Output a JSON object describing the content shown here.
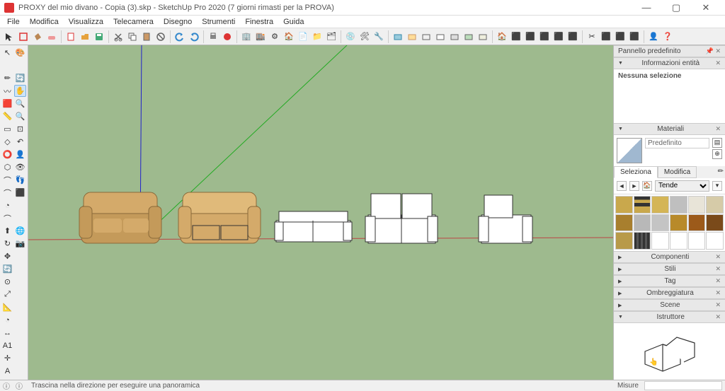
{
  "window": {
    "title": "PROXY del mio divano - Copia (3).skp - SketchUp Pro 2020 (7 giorni rimasti per la PROVA)"
  },
  "menu": [
    "File",
    "Modifica",
    "Visualizza",
    "Telecamera",
    "Disegno",
    "Strumenti",
    "Finestra",
    "Guida"
  ],
  "panels": {
    "default_tray": "Pannello predefinito",
    "entity_info": "Informazioni entità",
    "no_selection": "Nessuna selezione",
    "materials": "Materiali",
    "material_name": "Predefinito",
    "tab_select": "Seleziona",
    "tab_edit": "Modifica",
    "category": "Tende",
    "components": "Componenti",
    "styles": "Stili",
    "tag": "Tag",
    "shadows": "Ombreggiatura",
    "scenes": "Scene",
    "instructor": "Istruttore"
  },
  "statusbar": {
    "hint": "Trascina nella direzione per eseguire una panoramica",
    "measure_label": "Misure"
  },
  "material_swatches": [
    "#c9a84c",
    "linear-gradient(#333,#333 20%,#c9a84c 20%,#c9a84c 40%,#333 40%,#333 60%,#c9a84c 60%)",
    "#d4b556",
    "#bfbfbf",
    "#e8e4d8",
    "#d6cba8",
    "#a87f2e",
    "#b8b8b8",
    "#c4c4c4",
    "#b88a2a",
    "#9c5a1a",
    "#7a4a1a",
    "#b89a4a",
    "repeating-linear-gradient(90deg,#333 0 3px,#555 3px 6px)",
    "#fff",
    "#fff",
    "#fff",
    "#fff"
  ]
}
